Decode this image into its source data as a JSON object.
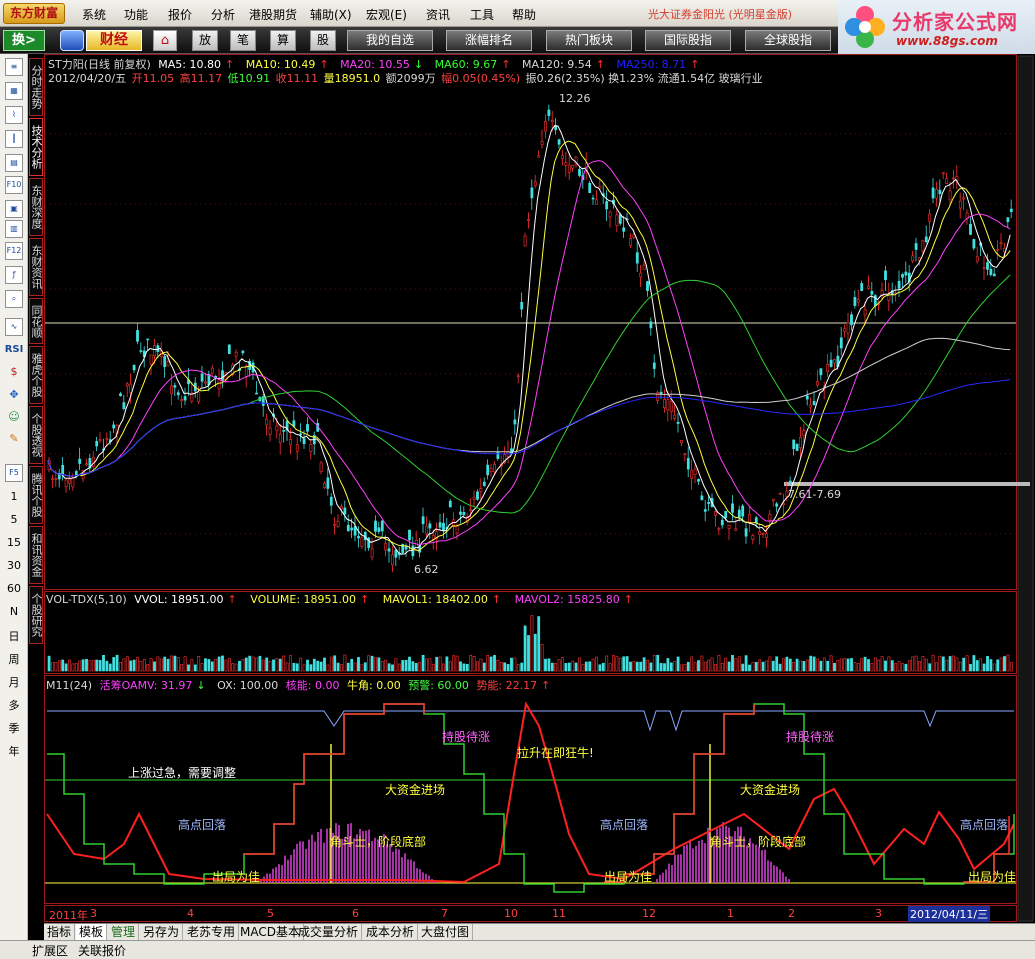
{
  "menu": {
    "logo": "东方财富",
    "items": [
      "系统",
      "功能",
      "报价",
      "分析",
      "港股期货",
      "辅助(X)",
      "宏观(E)",
      "资讯",
      "工具",
      "帮助"
    ],
    "broker": "光大证券金阳光 (光明星金版)"
  },
  "brand": {
    "title": "分析家公式网",
    "url": "www.88gs.com"
  },
  "toolbar": {
    "switch_label": "换>",
    "caijing_label": "财经",
    "buttons": [
      "放",
      "笔",
      "算",
      "股"
    ],
    "big_buttons": [
      "我的自选",
      "涨幅排名",
      "热门板块",
      "国际股指",
      "全球股指"
    ]
  },
  "left": {
    "periods": [
      "1",
      "5",
      "15",
      "30",
      "60",
      "N",
      "日",
      "周",
      "月",
      "多",
      "季",
      "年"
    ],
    "icon_labels": [
      "F10",
      "F12",
      "RSI",
      "F5"
    ]
  },
  "vtabs": [
    "分时走势",
    "技术分析",
    "东财深度",
    "东财资讯",
    "同花顺",
    "雅虎个股",
    "个股透视",
    "腾讯个股",
    "和讯资金",
    "个股研究"
  ],
  "main_header": {
    "name": "ST力阳(日线 前复权)",
    "ma": [
      {
        "label": "MA5: 10.80",
        "color": "#ffffff"
      },
      {
        "label": "MA10: 10.49",
        "color": "#ffff40"
      },
      {
        "label": "MA20: 10.55",
        "color": "#ff40ff"
      },
      {
        "label": "MA60: 9.67",
        "color": "#30ff30"
      },
      {
        "label": "MA120: 9.54",
        "color": "#d8d8d8"
      },
      {
        "label": "MA250: 8.71",
        "color": "#2020ff"
      }
    ],
    "quote_date": "2012/04/20/五",
    "quote_open": "开11.05",
    "quote_high": "高11.17",
    "quote_low": "低10.91",
    "quote_close": "收11.11",
    "quote_vol": "量18951.0",
    "quote_amt": "额2099万",
    "quote_chg": "幅0.05(0.45%)",
    "quote_rest": "振0.26(2.35%) 换1.23% 流通1.54亿 玻璃行业"
  },
  "annotations": {
    "high": "12.26",
    "low": "6.62",
    "range": "7.61-7.69"
  },
  "vol_header": [
    {
      "label": "VOL-TDX(5,10)",
      "color": "#d8d8d8"
    },
    {
      "label": "VVOL: 18951.00",
      "color": "#ffffff"
    },
    {
      "label": "VOLUME: 18951.00",
      "color": "#ffff40"
    },
    {
      "label": "MAVOL1: 18402.00",
      "color": "#ffff40"
    },
    {
      "label": "MAVOL2: 15825.80",
      "color": "#ff40ff"
    }
  ],
  "ind_header": [
    {
      "label": "M11(24)",
      "color": "#d8d8d8"
    },
    {
      "label": "活筹OAMV: 31.97",
      "color": "#ff40ff"
    },
    {
      "label": "OX: 100.00",
      "color": "#d8d8d8"
    },
    {
      "label": "核能: 0.00",
      "color": "#ff40ff"
    },
    {
      "label": "牛角: 0.00",
      "color": "#ffff40"
    },
    {
      "label": "预警: 60.00",
      "color": "#40ff40"
    },
    {
      "label": "势能: 22.17",
      "color": "#ff4040"
    }
  ],
  "ind_labels": {
    "l1": "上涨过急，需要调整",
    "l2": "高点回落",
    "l3": "出局为佳",
    "l4": "角斗士，阶段底部",
    "l5": "大资金进场",
    "l6": "持股待涨",
    "l7": "拉升在即狂牛!",
    "l8": "出局为佳",
    "l9": "高点回落",
    "l10": "大资金进场",
    "l11": "角斗士，阶段底部",
    "l12": "持股待涨",
    "l13": "高点回落",
    "l14": "出局为佳"
  },
  "timeline": {
    "first": "2011年",
    "months": [
      "3",
      "4",
      "5",
      "6",
      "7",
      "10",
      "11",
      "12",
      "1",
      "2",
      "3"
    ],
    "current_date": "2012/04/11/三"
  },
  "bottom_tabs": [
    "指标",
    "模板",
    "管理",
    "另存为",
    "老苏专用",
    "MACD基本",
    "成交量分析",
    "成本分析",
    "大盘付图"
  ],
  "status": [
    "扩展区",
    "关联报价"
  ]
}
